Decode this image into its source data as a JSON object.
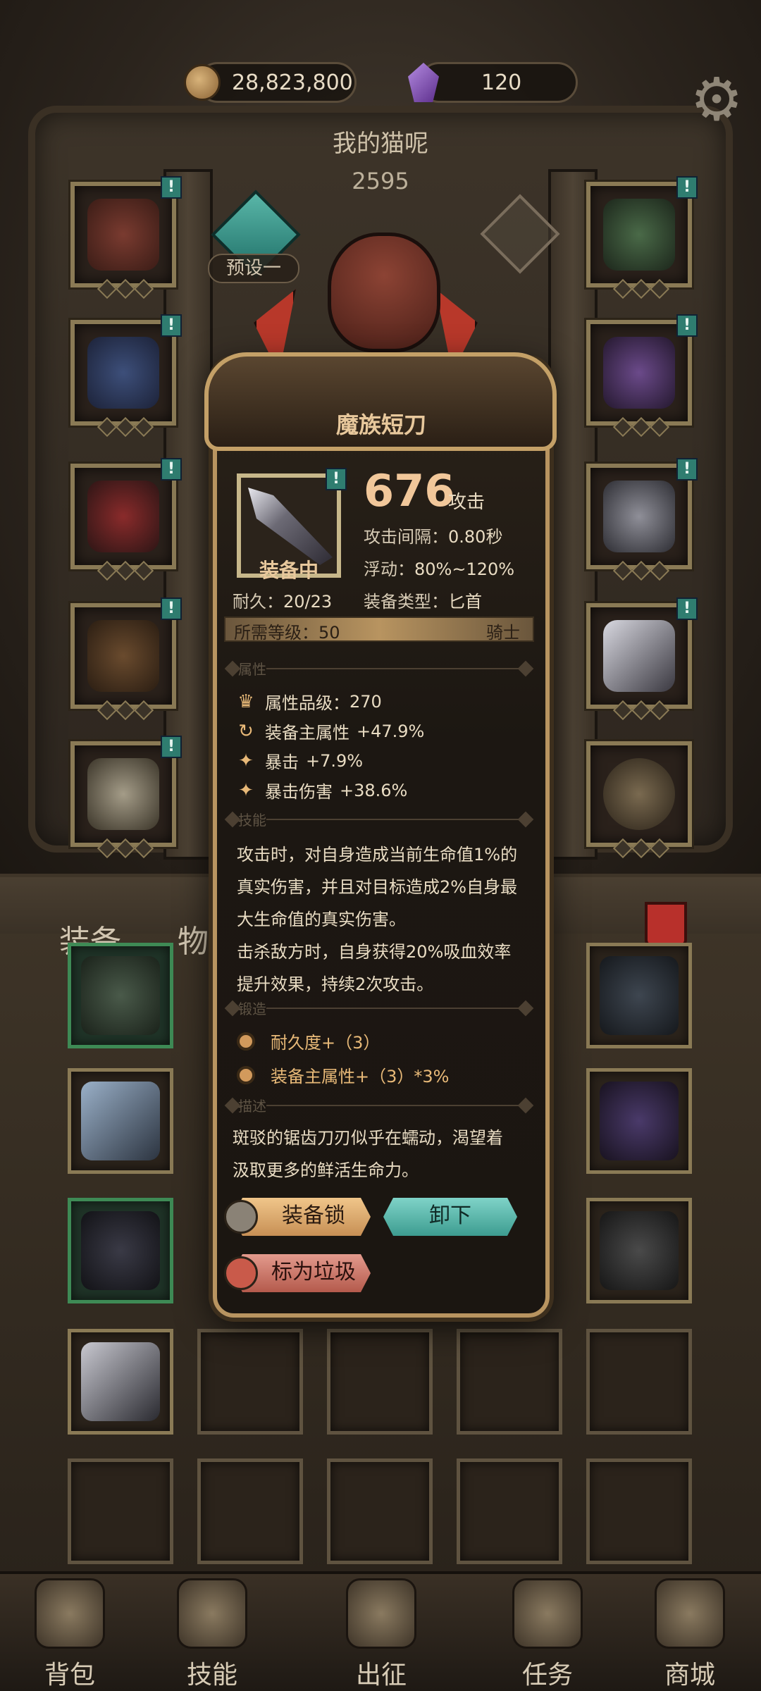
{
  "resources": {
    "gold": "28,823,800",
    "gems": "120"
  },
  "header": {
    "title": "我的猫呢",
    "power": "2595",
    "preset_label": "预设一"
  },
  "inventory": {
    "tab_equipment": "装备",
    "tab_items": "物"
  },
  "popup": {
    "name": "魔族短刀",
    "equipped_label": "装备中",
    "attack_value": "676",
    "attack_unit": "攻击",
    "interval_label": "攻击间隔：",
    "interval_value": "0.80秒",
    "float_label": "浮动：",
    "float_value": "80%~120%",
    "durability_label": "耐久：",
    "durability_value": "20/23",
    "type_label": "装备类型：",
    "type_value": "匕首",
    "level_label": "所需等级：",
    "level_value": "50",
    "class_name": "骑士",
    "sections": {
      "attributes": "属性",
      "skill": "技能",
      "forge": "锻造",
      "description": "描述"
    },
    "attributes": [
      {
        "icon": "quality-icon",
        "label": "属性品级：",
        "value": "270"
      },
      {
        "icon": "main-attr-icon",
        "label": "装备主属性",
        "value": "+47.9%"
      },
      {
        "icon": "crit-icon",
        "label": "暴击",
        "value": "+7.9%"
      },
      {
        "icon": "crit-damage-icon",
        "label": "暴击伤害",
        "value": "+38.6%"
      }
    ],
    "skill_lines": [
      "攻击时，对自身造成当前生命值1%的",
      "真实伤害，并且对目标造成2%自身最",
      "大生命值的真实伤害。",
      "击杀敌方时，自身获得20%吸血效率",
      "提升效果，持续2次攻击。"
    ],
    "forge": [
      "耐久度+（3）",
      "装备主属性+（3）*3%"
    ],
    "description_lines": [
      "斑驳的锯齿刀刃似乎在蠕动，渴望着",
      "汲取更多的鲜活生命力。"
    ],
    "buttons": {
      "lock": "装备锁",
      "unequip": "卸下",
      "mark_trash": "标为垃圾"
    }
  },
  "nav": [
    {
      "label": "背包"
    },
    {
      "label": "技能"
    },
    {
      "label": "出征"
    },
    {
      "label": "任务"
    },
    {
      "label": "商城"
    }
  ]
}
